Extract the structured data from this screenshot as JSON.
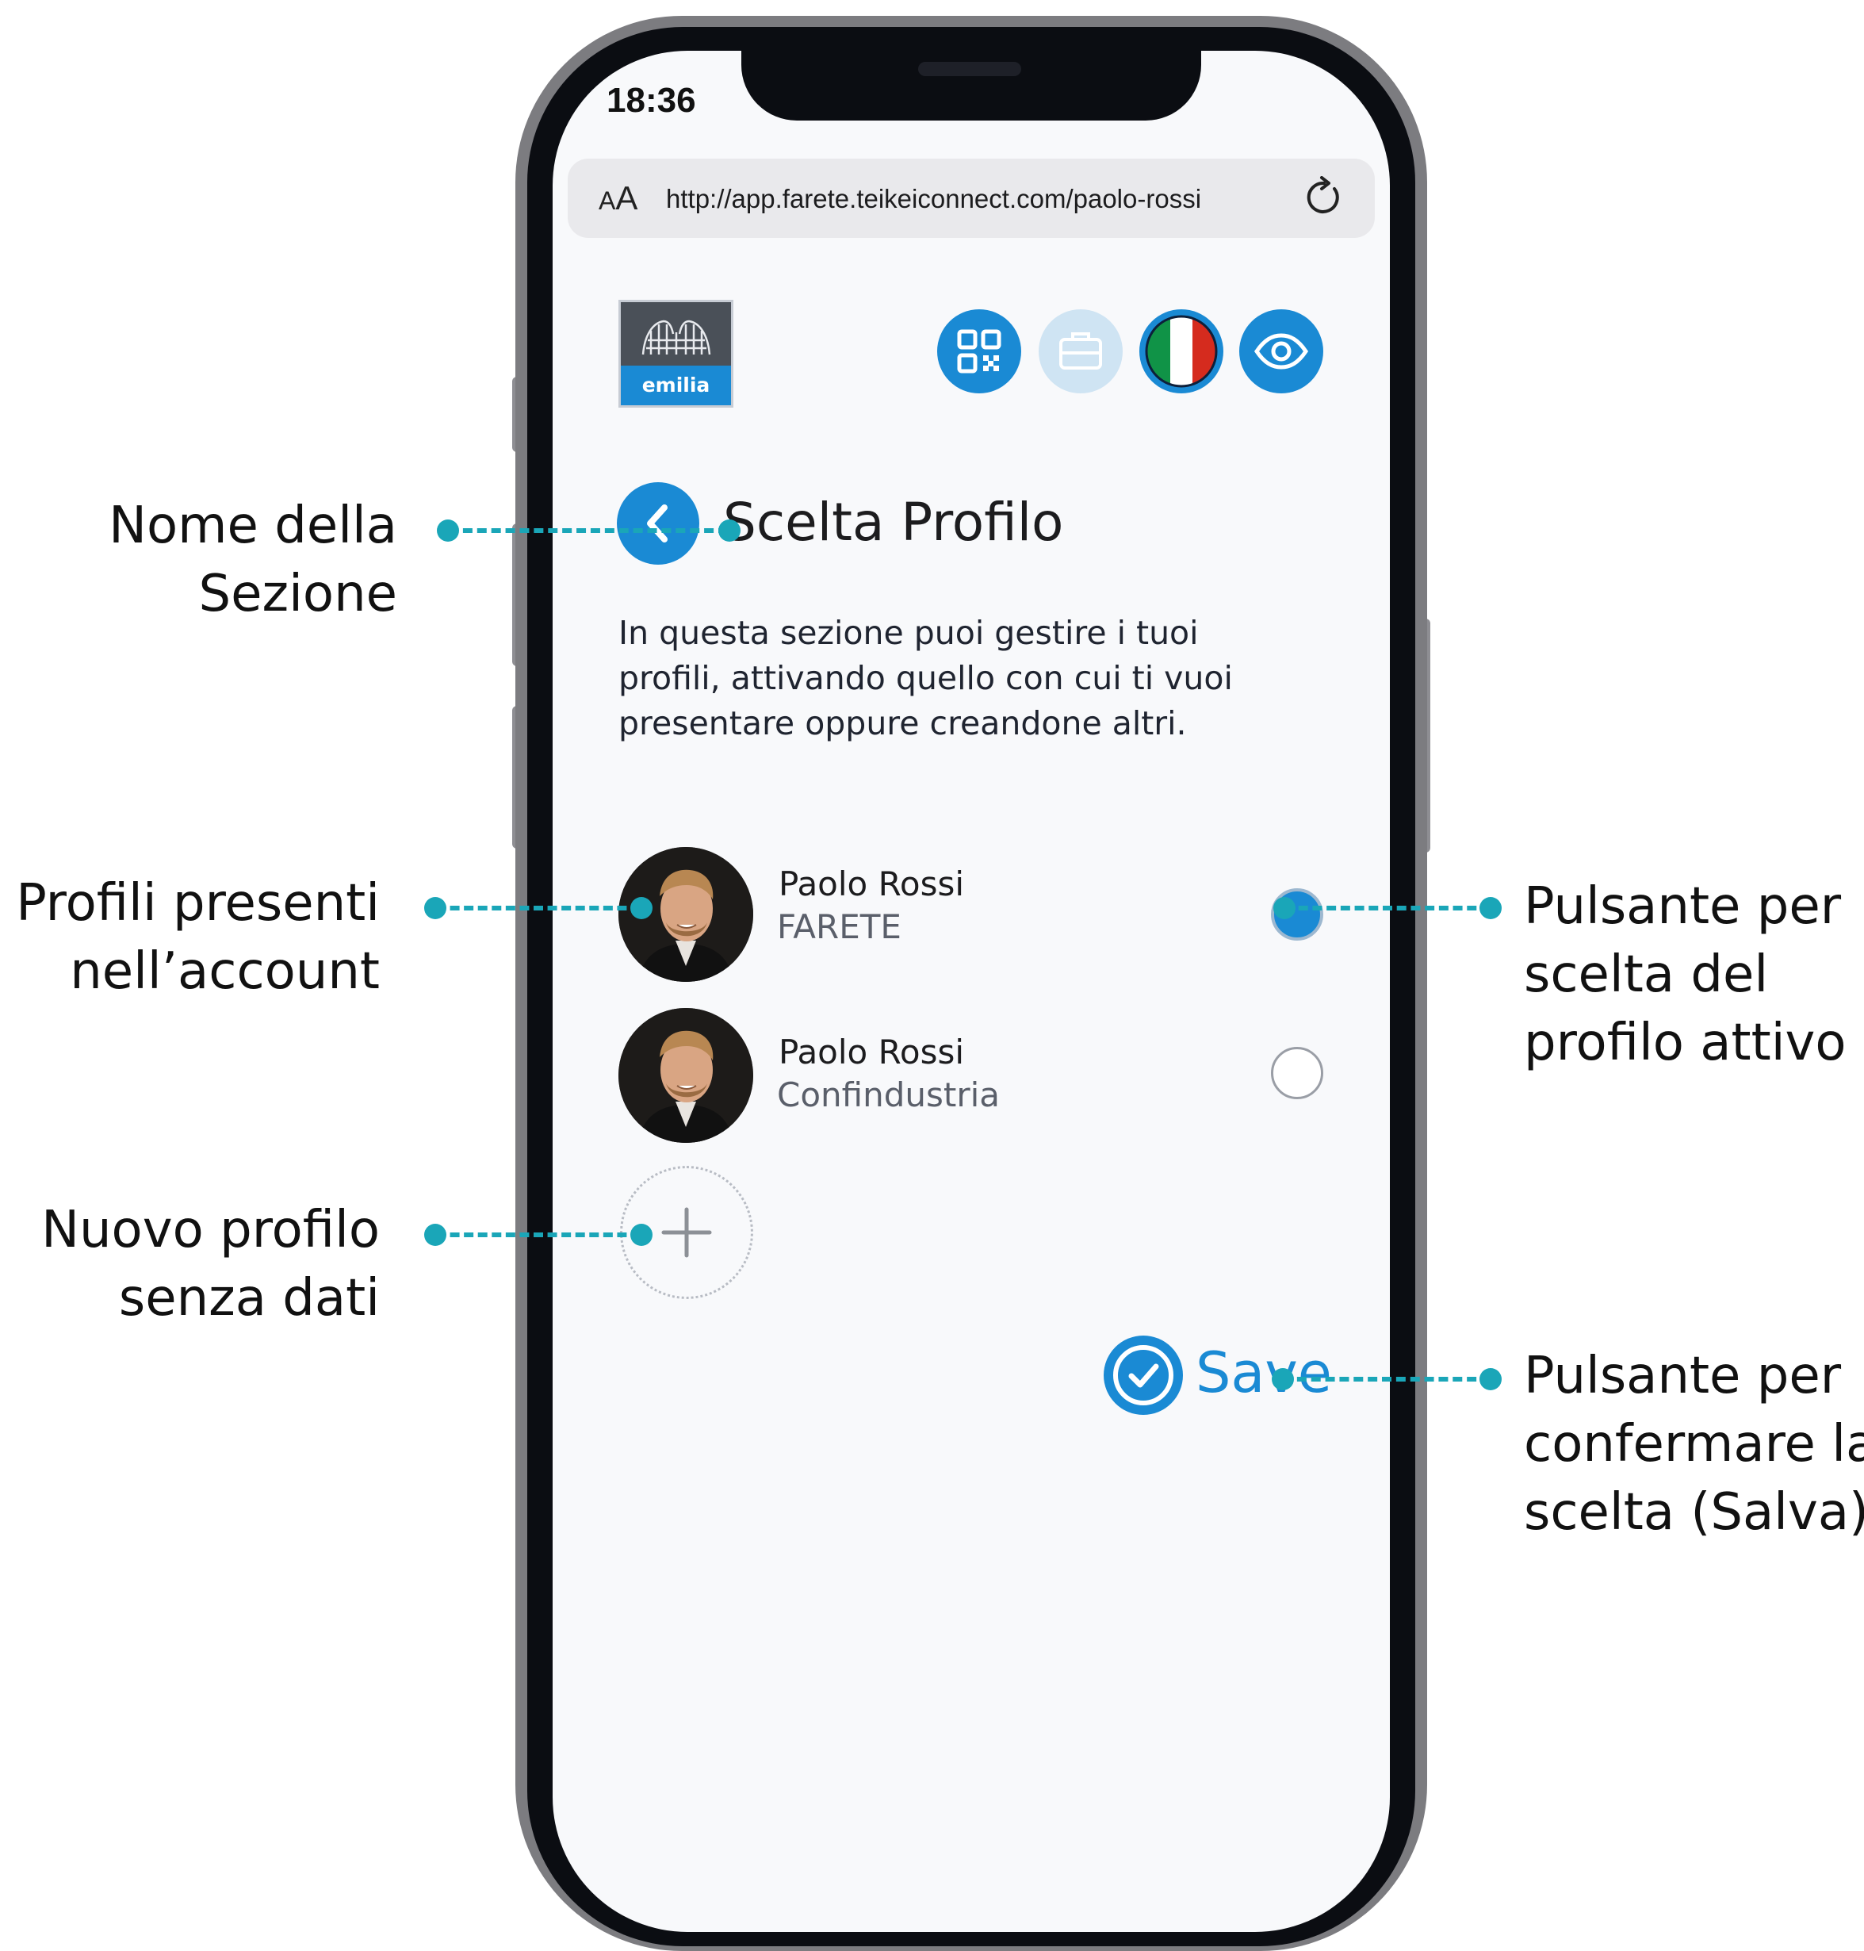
{
  "status_bar": {
    "time": "18:36"
  },
  "browser": {
    "text_size_small": "A",
    "text_size_big": "A",
    "url": "http://app.farete.teikeiconnect.com/paolo-rossi"
  },
  "header": {
    "logo_text": "emilia",
    "icons": [
      "qr-code-icon",
      "briefcase-icon",
      "italian-flag-icon",
      "eye-icon"
    ]
  },
  "section": {
    "title": "Scelta Profilo",
    "description_lines": [
      "In questa sezione puoi gestire i tuoi",
      "profili, attivando quello con cui ti vuoi",
      "presentare oppure creandone altri."
    ]
  },
  "profiles": [
    {
      "name": "Paolo Rossi",
      "organization": "FARETE",
      "active": true
    },
    {
      "name": "Paolo Rossi",
      "organization": "Confindustria",
      "active": false
    }
  ],
  "save_label": "Save",
  "annotations": {
    "section_name": [
      "Nome della",
      "Sezione"
    ],
    "profiles_present": [
      "Profili presenti",
      "nell’account"
    ],
    "new_profile": [
      "Nuovo profilo",
      "senza dati"
    ],
    "active_button": [
      "Pulsante per",
      "scelta del",
      "profilo attivo"
    ],
    "confirm_button": [
      "Pulsante per",
      "confermare la",
      "scelta (Salva)"
    ]
  },
  "colors": {
    "accent": "#1a8ad4",
    "annotation": "#1aa6b8",
    "flag_green": "#109347",
    "flag_red": "#d52b1e"
  }
}
